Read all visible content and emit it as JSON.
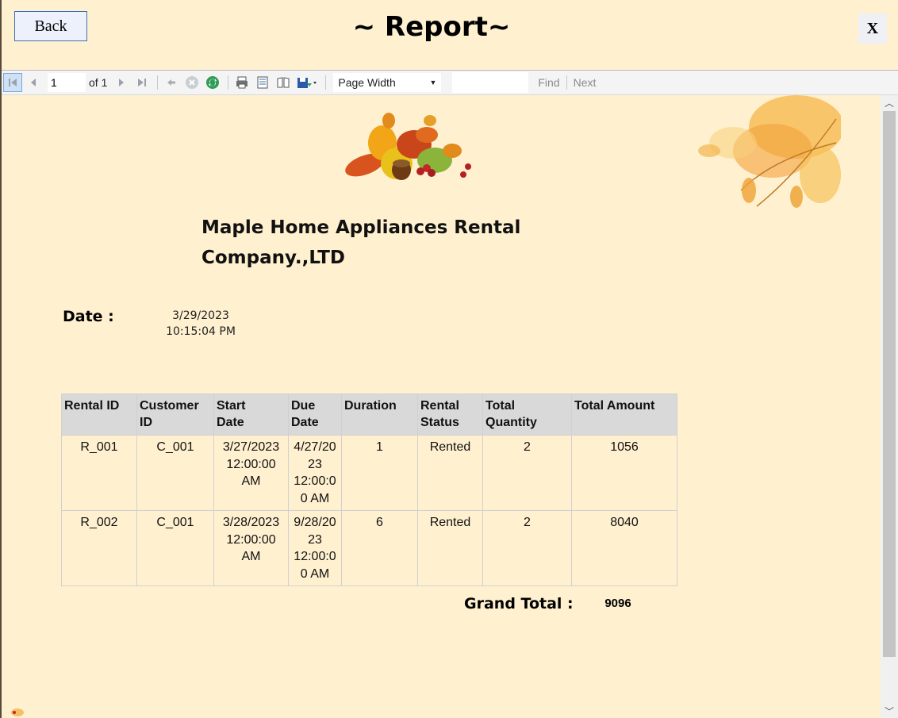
{
  "window": {
    "back_label": "Back",
    "title": "~ Report~",
    "close_label": "X"
  },
  "toolbar": {
    "page_value": "1",
    "of_label": "of 1",
    "zoom_value": "Page Width",
    "find_label": "Find",
    "next_label": "Next"
  },
  "report": {
    "company_line1": "Maple Home Appliances Rental",
    "company_line2": "Company.,LTD",
    "date_label": "Date :",
    "date_line1": "3/29/2023",
    "date_line2": "10:15:04 PM",
    "columns": [
      [
        "Rental ID"
      ],
      [
        "Customer",
        "ID"
      ],
      [
        "Start",
        "Date"
      ],
      [
        "Due",
        "Date"
      ],
      [
        "Duration"
      ],
      [
        "Rental",
        "Status"
      ],
      [
        "Total",
        "Quantity"
      ],
      [
        "Total Amount"
      ]
    ],
    "rows": [
      {
        "rental_id": "R_001",
        "customer_id": "C_001",
        "start_date": [
          "3/27/2023",
          "12:00:00",
          "AM"
        ],
        "due_date": [
          "4/27/20",
          "23",
          "12:00:0",
          "0 AM"
        ],
        "duration": "1",
        "status": "Rented",
        "quantity": "2",
        "amount": "1056"
      },
      {
        "rental_id": "R_002",
        "customer_id": "C_001",
        "start_date": [
          "3/28/2023",
          "12:00:00",
          "AM"
        ],
        "due_date": [
          "9/28/20",
          "23",
          "12:00:0",
          "0 AM"
        ],
        "duration": "6",
        "status": "Rented",
        "quantity": "2",
        "amount": "8040"
      }
    ],
    "grand_total_label": "Grand Total :",
    "grand_total_value": "9096"
  },
  "icons": {
    "first_page": "first-page-icon",
    "prev_page": "previous-page-icon",
    "next_page": "next-page-icon",
    "last_page": "last-page-icon",
    "back_nav": "back-arrow-icon",
    "stop": "stop-icon",
    "refresh": "refresh-icon",
    "print": "print-icon",
    "print_layout": "print-layout-icon",
    "page_setup": "page-setup-icon",
    "export": "export-save-icon"
  },
  "colors": {
    "background": "#fff1d0",
    "header_row": "#d9d9d9",
    "accent_border": "#3b6fb6"
  }
}
